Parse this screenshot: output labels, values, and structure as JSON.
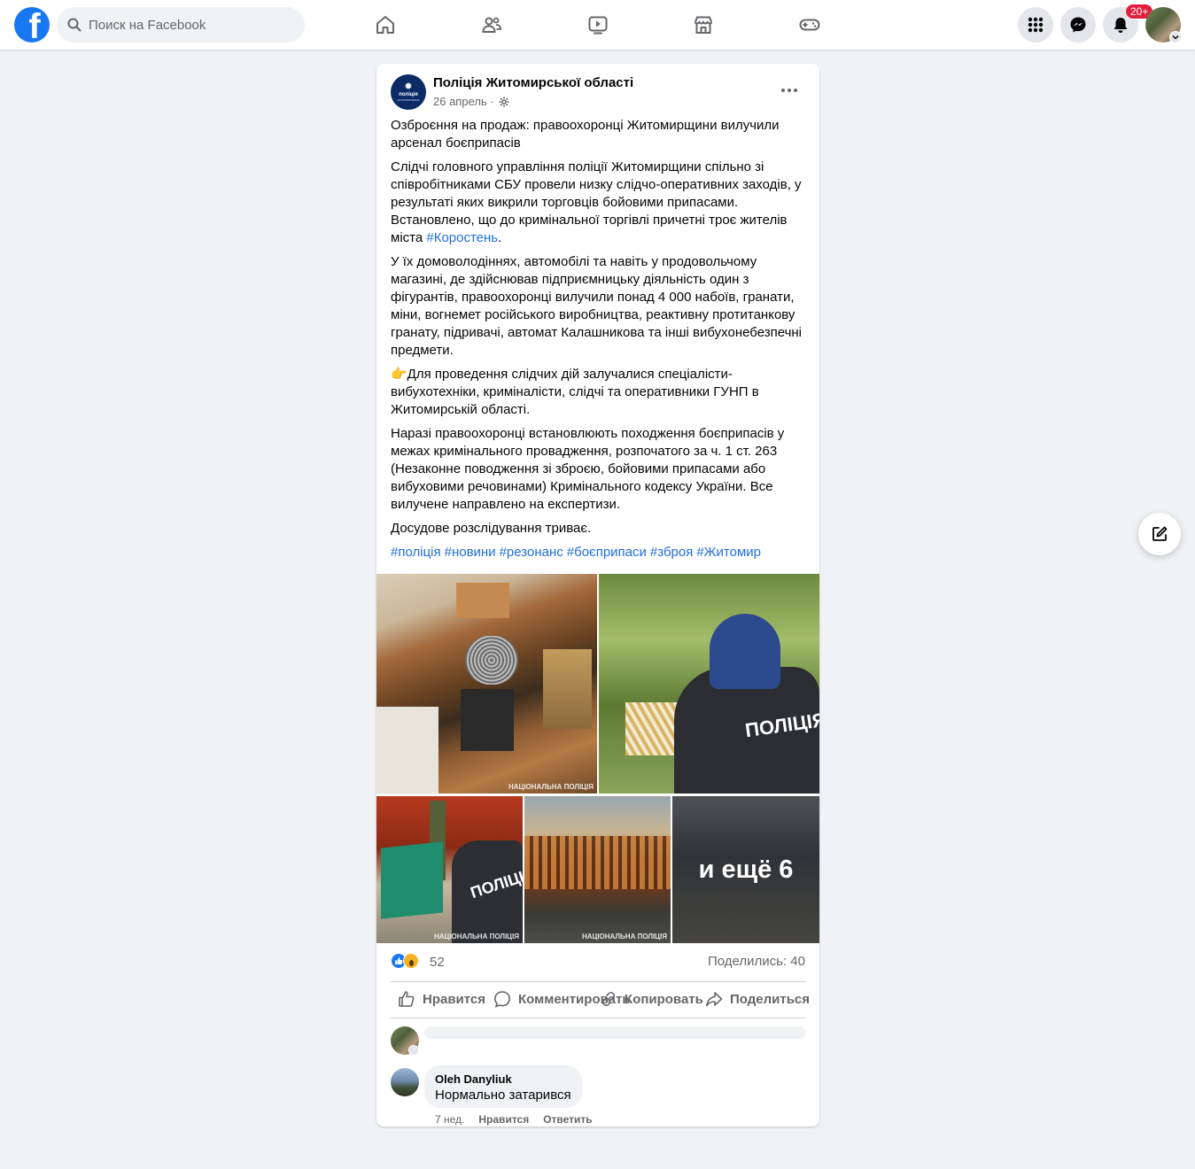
{
  "topbar": {
    "logo": "facebook-logo",
    "logo_letter": "f",
    "search_placeholder": "Поиск на Facebook",
    "nav_icons": [
      "home-icon",
      "friends-icon",
      "watch-icon",
      "marketplace-icon",
      "gaming-icon"
    ],
    "notification_badge": "20+"
  },
  "post": {
    "page_name": "Поліція Житомирської області",
    "avatar_text": "поліція",
    "avatar_subtext": "ЖИТОМИРЩИНИ",
    "date": "26 апрель",
    "date_separator": " · ",
    "paragraphs": [
      "Озброєння на продаж: правоохоронці Житомирщини вилучили арсенал боєприпасів",
      "Слідчі головного управління поліції Житомирщини спільно зі співробітниками СБУ провели низку слідчо-оперативних заходів, у результаті яких викрили торговців бойовими припасами. Встановлено, що до кримінальної торгівлі причетні троє жителів міста ",
      "У їх домоволодіннях, автомобілі та навіть у продовольчому магазині, де здійснював підприємницьку діяльність один з фігурантів, правоохоронці вилучили понад 4 000 набоїв, гранати, міни, вогнемет російського виробництва, реактивну протитанкову гранату, підривачі, автомат Калашникова та інші вибухонебезпечні предмети.",
      "👉Для проведення слідчих дій залучалися спеціалісти-вибухотехніки, криміналісти, слідчі та оперативники ГУНП в Житомирській області.",
      "Наразі правоохоронці встановлюють походження боєприпасів у межах кримінального провадження, розпочатого за ч. 1 ст. 263 (Незаконне поводження зі зброєю, бойовими припасами або вибуховими речовинами) Кримінального кодексу України. Все вилучене направлено на експертизи.",
      "Досудове розслідування триває."
    ],
    "inline_hashtag": "#Коростень",
    "inline_hashtag_after": ".",
    "hashtags": [
      "#поліція",
      "#новини",
      "#резонанс",
      "#боєприпаси",
      "#зброя",
      "#Житомир"
    ],
    "photo_label_1": "ПОЛІЦІЯ",
    "photo_label_2": "ПОЛІЦІЯ",
    "watermark": "НАЦІОНАЛЬНА ПОЛІЦІЯ",
    "more_photos": "и ещё 6",
    "reaction_count": "52",
    "shares": "Поделились: 40",
    "actions": {
      "like": "Нравится",
      "comment": "Комментировать",
      "copy": "Копировать",
      "share": "Поделиться"
    }
  },
  "comment": {
    "author": "Oleh Danyliuk",
    "text": "Нормально затарився",
    "time": "7 нед.",
    "like": "Нравится",
    "reply": "Ответить"
  },
  "colors": {
    "brand": "#1877f2",
    "link": "#216fdb",
    "badge": "#e41e3f",
    "background": "#f0f2f5"
  }
}
